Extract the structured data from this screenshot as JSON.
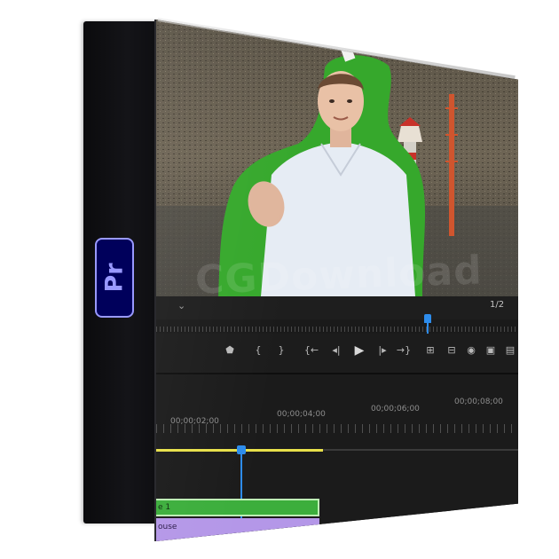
{
  "product": {
    "logo_text": "Pr",
    "brand_color": "#9999ff",
    "brand_bg": "#00005b"
  },
  "watermark": {
    "text": "CGDownload"
  },
  "monitor": {
    "dropdown_icon": "chevron-down-icon",
    "resolution": "1/2"
  },
  "transport": {
    "buttons": [
      {
        "name": "add-marker-button",
        "glyph": "⬟"
      },
      {
        "name": "mark-in-button",
        "glyph": "{"
      },
      {
        "name": "mark-out-button",
        "glyph": "}"
      },
      {
        "name": "go-to-in-button",
        "glyph": "{←"
      },
      {
        "name": "step-back-button",
        "glyph": "◂|"
      },
      {
        "name": "play-button",
        "glyph": "▶"
      },
      {
        "name": "step-forward-button",
        "glyph": "|▸"
      },
      {
        "name": "go-to-out-button",
        "glyph": "→}"
      },
      {
        "name": "lift-button",
        "glyph": "⊞"
      },
      {
        "name": "extract-button",
        "glyph": "⊟"
      },
      {
        "name": "export-frame-button",
        "glyph": "◉"
      },
      {
        "name": "comparison-view-button",
        "glyph": "▣"
      },
      {
        "name": "button-editor-button",
        "glyph": "▤"
      }
    ]
  },
  "timeline": {
    "timecodes": [
      "00;00;02;00",
      "00;00;04;00",
      "00;00;06;00",
      "00;00;08;00"
    ],
    "video_clip_label": "e 1",
    "audio_clip_label": "ouse",
    "work_area_color": "#e8e04a",
    "playhead_color": "#2d8ceb",
    "video_clip_color": "#3cae3c",
    "audio_clip_color": "#b497e8"
  }
}
